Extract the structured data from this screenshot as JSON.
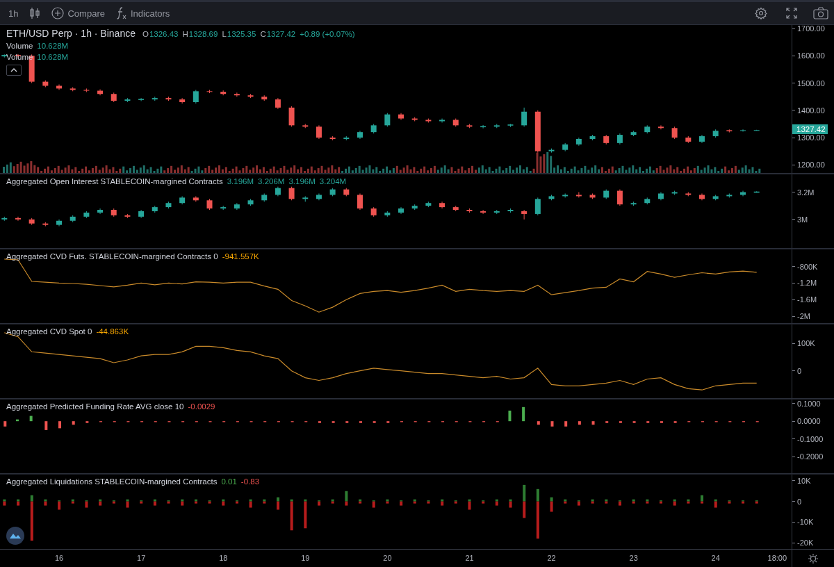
{
  "toolbar": {
    "interval": "1h",
    "compare": "Compare",
    "indicators": "Indicators"
  },
  "panes": [
    {
      "legend": {
        "title": "ETH/USD Perp · 1h · Binance",
        "ohlc": [
          {
            "label": "O",
            "value": "1326.43"
          },
          {
            "label": "H",
            "value": "1328.69"
          },
          {
            "label": "L",
            "value": "1325.35"
          },
          {
            "label": "C",
            "value": "1327.42"
          }
        ],
        "change": "+0.89 (+0.07%)",
        "studies": [
          {
            "name": "Volume",
            "value": "10.628M"
          },
          {
            "name": "Volume",
            "value": "10.628M"
          }
        ]
      },
      "last_price": "1327.42",
      "chart_data": {
        "type": "candlestick",
        "ylim": [
          1170,
          1713
        ],
        "yticks": [
          {
            "value": 1700,
            "label": "1700.00"
          },
          {
            "value": 1600,
            "label": "1600.00"
          },
          {
            "value": 1500,
            "label": "1500.00"
          },
          {
            "value": 1400,
            "label": "1400.00"
          },
          {
            "value": 1300,
            "label": "1300.00"
          },
          {
            "value": 1200,
            "label": "1200.00"
          }
        ],
        "categories": [
          null,
          null,
          null,
          null,
          null,
          null,
          null,
          null,
          null,
          null,
          null,
          null,
          null,
          null,
          null,
          null,
          null,
          null,
          null,
          null,
          null,
          null,
          null,
          null,
          null,
          null,
          null,
          null,
          null,
          null,
          null,
          null,
          null,
          null,
          null,
          null,
          null,
          null,
          null,
          null,
          null,
          null,
          null,
          null,
          null,
          null,
          null,
          null,
          null,
          null,
          null,
          null,
          null,
          null,
          null,
          null
        ],
        "ohlc": [
          [
            1598,
            1605,
            1594,
            1603
          ],
          [
            1603,
            1606,
            1594,
            1599
          ],
          [
            1600,
            1605,
            1500,
            1505
          ],
          [
            1505,
            1510,
            1485,
            1490
          ],
          [
            1490,
            1495,
            1475,
            1480
          ],
          [
            1480,
            1485,
            1470,
            1475
          ],
          [
            1475,
            1480,
            1467,
            1472
          ],
          [
            1472,
            1477,
            1455,
            1460
          ],
          [
            1460,
            1465,
            1430,
            1435
          ],
          [
            1435,
            1445,
            1430,
            1440
          ],
          [
            1438,
            1445,
            1434,
            1442
          ],
          [
            1440,
            1450,
            1435,
            1445
          ],
          [
            1445,
            1450,
            1435,
            1440
          ],
          [
            1440,
            1445,
            1425,
            1430
          ],
          [
            1430,
            1475,
            1425,
            1470
          ],
          [
            1470,
            1475,
            1463,
            1468
          ],
          [
            1468,
            1473,
            1455,
            1460
          ],
          [
            1460,
            1465,
            1450,
            1455
          ],
          [
            1455,
            1460,
            1445,
            1450
          ],
          [
            1450,
            1455,
            1435,
            1440
          ],
          [
            1440,
            1445,
            1405,
            1410
          ],
          [
            1410,
            1415,
            1340,
            1345
          ],
          [
            1345,
            1350,
            1335,
            1340
          ],
          [
            1340,
            1345,
            1295,
            1300
          ],
          [
            1300,
            1305,
            1290,
            1295
          ],
          [
            1295,
            1305,
            1290,
            1300
          ],
          [
            1300,
            1325,
            1295,
            1320
          ],
          [
            1320,
            1350,
            1315,
            1345
          ],
          [
            1345,
            1390,
            1340,
            1385
          ],
          [
            1385,
            1390,
            1365,
            1370
          ],
          [
            1370,
            1375,
            1360,
            1365
          ],
          [
            1365,
            1370,
            1355,
            1360
          ],
          [
            1360,
            1370,
            1355,
            1365
          ],
          [
            1365,
            1370,
            1340,
            1345
          ],
          [
            1345,
            1350,
            1335,
            1340
          ],
          [
            1338,
            1346,
            1334,
            1342
          ],
          [
            1340,
            1350,
            1335,
            1345
          ],
          [
            1344,
            1350,
            1339,
            1348
          ],
          [
            1345,
            1410,
            1340,
            1395
          ],
          [
            1395,
            1400,
            1245,
            1250
          ],
          [
            1250,
            1260,
            1245,
            1255
          ],
          [
            1255,
            1280,
            1250,
            1275
          ],
          [
            1275,
            1300,
            1270,
            1295
          ],
          [
            1295,
            1310,
            1290,
            1305
          ],
          [
            1305,
            1310,
            1275,
            1280
          ],
          [
            1280,
            1315,
            1275,
            1310
          ],
          [
            1310,
            1325,
            1305,
            1320
          ],
          [
            1320,
            1345,
            1315,
            1340
          ],
          [
            1340,
            1345,
            1330,
            1335
          ],
          [
            1335,
            1340,
            1295,
            1300
          ],
          [
            1300,
            1305,
            1280,
            1285
          ],
          [
            1285,
            1310,
            1280,
            1305
          ],
          [
            1305,
            1330,
            1300,
            1325
          ],
          [
            1327,
            1330,
            1319,
            1323
          ],
          [
            1325,
            1330,
            1322,
            1327
          ],
          [
            1326.43,
            1328.69,
            1325.35,
            1327.42
          ]
        ]
      }
    },
    {
      "legend": {
        "title": "Aggregated Open Interest STABLECOIN-margined Contracts",
        "values": [
          {
            "text": "3.196M",
            "color": "#26a69a"
          },
          {
            "text": "3.206M",
            "color": "#26a69a"
          },
          {
            "text": "3.196M",
            "color": "#26a69a"
          },
          {
            "text": "3.204M",
            "color": "#26a69a"
          }
        ]
      },
      "chart_data": {
        "type": "candlestick",
        "ylim": [
          2.79,
          3.33
        ],
        "yticks": [
          {
            "value": 3.2,
            "label": "3.2M"
          },
          {
            "value": 3,
            "label": "3M"
          }
        ],
        "categories": [
          null,
          null,
          null,
          null,
          null,
          null,
          null,
          null,
          null,
          null,
          null,
          null,
          null,
          null,
          null,
          null,
          null,
          null,
          null,
          null,
          null,
          null,
          null,
          null,
          null,
          null,
          null,
          null,
          null,
          null,
          null,
          null,
          null,
          null,
          null,
          null,
          null,
          null,
          null,
          null,
          null,
          null,
          null,
          null,
          null,
          null,
          null,
          null,
          null,
          null,
          null,
          null,
          null,
          null,
          null,
          null
        ],
        "ohlc": [
          [
            3.0,
            3.02,
            2.99,
            3.01
          ],
          [
            3.01,
            3.02,
            2.99,
            3.0
          ],
          [
            3.0,
            3.01,
            2.96,
            2.97
          ],
          [
            2.97,
            2.98,
            2.95,
            2.96
          ],
          [
            2.96,
            3.0,
            2.95,
            2.99
          ],
          [
            2.99,
            3.03,
            2.98,
            3.02
          ],
          [
            3.02,
            3.06,
            3.01,
            3.05
          ],
          [
            3.05,
            3.08,
            3.04,
            3.07
          ],
          [
            3.07,
            3.08,
            3.02,
            3.03
          ],
          [
            3.03,
            3.04,
            3.01,
            3.02
          ],
          [
            3.02,
            3.07,
            3.01,
            3.06
          ],
          [
            3.06,
            3.1,
            3.05,
            3.09
          ],
          [
            3.09,
            3.13,
            3.08,
            3.12
          ],
          [
            3.12,
            3.17,
            3.11,
            3.16
          ],
          [
            3.16,
            3.17,
            3.13,
            3.14
          ],
          [
            3.14,
            3.15,
            3.07,
            3.08
          ],
          [
            3.08,
            3.1,
            3.07,
            3.09
          ],
          [
            3.08,
            3.12,
            3.07,
            3.11
          ],
          [
            3.11,
            3.15,
            3.1,
            3.14
          ],
          [
            3.14,
            3.19,
            3.13,
            3.18
          ],
          [
            3.18,
            3.24,
            3.17,
            3.23
          ],
          [
            3.23,
            3.24,
            3.14,
            3.15
          ],
          [
            3.15,
            3.17,
            3.13,
            3.16
          ],
          [
            3.15,
            3.19,
            3.14,
            3.18
          ],
          [
            3.18,
            3.23,
            3.17,
            3.22
          ],
          [
            3.22,
            3.23,
            3.17,
            3.18
          ],
          [
            3.18,
            3.19,
            3.07,
            3.08
          ],
          [
            3.08,
            3.09,
            3.02,
            3.03
          ],
          [
            3.03,
            3.06,
            3.02,
            3.05
          ],
          [
            3.05,
            3.09,
            3.04,
            3.08
          ],
          [
            3.08,
            3.11,
            3.07,
            3.1
          ],
          [
            3.1,
            3.13,
            3.09,
            3.12
          ],
          [
            3.12,
            3.13,
            3.08,
            3.09
          ],
          [
            3.09,
            3.1,
            3.06,
            3.07
          ],
          [
            3.07,
            3.08,
            3.05,
            3.06
          ],
          [
            3.06,
            3.07,
            3.04,
            3.05
          ],
          [
            3.05,
            3.07,
            3.04,
            3.06
          ],
          [
            3.06,
            3.08,
            3.05,
            3.07
          ],
          [
            3.06,
            3.07,
            3.0,
            3.04
          ],
          [
            3.04,
            3.16,
            3.03,
            3.15
          ],
          [
            3.15,
            3.18,
            3.14,
            3.17
          ],
          [
            3.17,
            3.19,
            3.16,
            3.18
          ],
          [
            3.18,
            3.2,
            3.16,
            3.17
          ],
          [
            3.18,
            3.19,
            3.15,
            3.16
          ],
          [
            3.16,
            3.22,
            3.15,
            3.21
          ],
          [
            3.21,
            3.22,
            3.1,
            3.11
          ],
          [
            3.11,
            3.13,
            3.1,
            3.12
          ],
          [
            3.12,
            3.16,
            3.11,
            3.15
          ],
          [
            3.15,
            3.2,
            3.14,
            3.19
          ],
          [
            3.19,
            3.21,
            3.18,
            3.2
          ],
          [
            3.19,
            3.2,
            3.17,
            3.18
          ],
          [
            3.18,
            3.19,
            3.14,
            3.15
          ],
          [
            3.15,
            3.18,
            3.14,
            3.17
          ],
          [
            3.17,
            3.19,
            3.16,
            3.18
          ],
          [
            3.18,
            3.21,
            3.17,
            3.2
          ],
          [
            3.196,
            3.206,
            3.196,
            3.204
          ]
        ]
      }
    },
    {
      "legend": {
        "title": "Aggregated CVD Futs. STABLECOIN-margined Contracts 0",
        "values": [
          {
            "text": "-941.557K",
            "color": "#f7a600"
          }
        ]
      },
      "chart_data": {
        "type": "line",
        "ylim": [
          -2164000,
          -389000
        ],
        "yticks": [
          {
            "value": -800000,
            "label": "-800K"
          },
          {
            "value": -1200000,
            "label": "-1.2M"
          },
          {
            "value": -1600000,
            "label": "-1.6M"
          },
          {
            "value": -2000000,
            "label": "-2M"
          }
        ],
        "categories": [
          null,
          null,
          null,
          null,
          null,
          null,
          null,
          null,
          null,
          null,
          null,
          null,
          null,
          null,
          null,
          null,
          null,
          null,
          null,
          null,
          null,
          null,
          null,
          null,
          null,
          null,
          null,
          null,
          null,
          null,
          null,
          null,
          null,
          null,
          null,
          null,
          null,
          null,
          null,
          null,
          null,
          null,
          null,
          null,
          null,
          null,
          null,
          null,
          null,
          null,
          null,
          null,
          null,
          null,
          null,
          null
        ],
        "series": [
          {
            "color": "#c98a2a",
            "values": [
              -620000,
              -640000,
              -1160000,
              -1180000,
              -1200000,
              -1210000,
              -1230000,
              -1260000,
              -1290000,
              -1250000,
              -1200000,
              -1240000,
              -1200000,
              -1220000,
              -1170000,
              -1180000,
              -1200000,
              -1180000,
              -1180000,
              -1270000,
              -1350000,
              -1620000,
              -1750000,
              -1900000,
              -1780000,
              -1600000,
              -1450000,
              -1400000,
              -1380000,
              -1420000,
              -1380000,
              -1320000,
              -1250000,
              -1400000,
              -1350000,
              -1380000,
              -1400000,
              -1380000,
              -1400000,
              -1250000,
              -1480000,
              -1430000,
              -1380000,
              -1320000,
              -1300000,
              -1100000,
              -1170000,
              -920000,
              -980000,
              -1060000,
              -1000000,
              -950000,
              -980000,
              -930000,
              -910000,
              -940000
            ]
          }
        ]
      }
    },
    {
      "legend": {
        "title": "Aggregated CVD Spot 0",
        "values": [
          {
            "text": "-44.863K",
            "color": "#f7a600"
          }
        ]
      },
      "chart_data": {
        "type": "line",
        "ylim": [
          -100000,
          170000
        ],
        "yticks": [
          {
            "value": 100000,
            "label": "100K"
          },
          {
            "value": 0,
            "label": "0"
          }
        ],
        "categories": [
          null,
          null,
          null,
          null,
          null,
          null,
          null,
          null,
          null,
          null,
          null,
          null,
          null,
          null,
          null,
          null,
          null,
          null,
          null,
          null,
          null,
          null,
          null,
          null,
          null,
          null,
          null,
          null,
          null,
          null,
          null,
          null,
          null,
          null,
          null,
          null,
          null,
          null,
          null,
          null,
          null,
          null,
          null,
          null,
          null,
          null,
          null,
          null,
          null,
          null,
          null,
          null,
          null,
          null,
          null,
          null
        ],
        "series": [
          {
            "color": "#c98a2a",
            "values": [
              140000,
              125000,
              70000,
              65000,
              60000,
              55000,
              50000,
              45000,
              30000,
              40000,
              55000,
              60000,
              60000,
              70000,
              90000,
              90000,
              85000,
              75000,
              70000,
              55000,
              45000,
              0,
              -25000,
              -35000,
              -25000,
              -10000,
              0,
              10000,
              5000,
              0,
              -5000,
              -10000,
              -10000,
              -15000,
              -20000,
              -25000,
              -20000,
              -30000,
              -25000,
              10000,
              -50000,
              -55000,
              -55000,
              -50000,
              -45000,
              -35000,
              -50000,
              -30000,
              -25000,
              -50000,
              -65000,
              -70000,
              -55000,
              -50000,
              -45000,
              -45000
            ]
          }
        ]
      }
    },
    {
      "legend": {
        "title": "Aggregated Predicted Funding Rate AVG close 10",
        "values": [
          {
            "text": "-0.0029",
            "color": "#ef5350"
          }
        ]
      },
      "chart_data": {
        "type": "bar",
        "ylim": [
          -0.2943,
          0.1226
        ],
        "yticks": [
          {
            "value": 0.1,
            "label": "0.1000"
          },
          {
            "value": 0,
            "label": "0.0000"
          },
          {
            "value": -0.1,
            "label": "-0.1000"
          },
          {
            "value": -0.2,
            "label": "-0.2000"
          }
        ],
        "categories": [
          null,
          null,
          null,
          null,
          null,
          null,
          null,
          null,
          null,
          null,
          null,
          null,
          null,
          null,
          null,
          null,
          null,
          null,
          null,
          null,
          null,
          null,
          null,
          null,
          null,
          null,
          null,
          null,
          null,
          null,
          null,
          null,
          null,
          null,
          null,
          null,
          null,
          null,
          null,
          null,
          null,
          null,
          null,
          null,
          null,
          null,
          null,
          null,
          null,
          null,
          null,
          null,
          null,
          null,
          null,
          null
        ],
        "series": [
          {
            "color": "#4caf50",
            "values": [
              null,
              0.01,
              0.03,
              null,
              null,
              null,
              null,
              null,
              null,
              null,
              null,
              null,
              null,
              null,
              null,
              null,
              null,
              null,
              null,
              null,
              null,
              null,
              null,
              null,
              null,
              null,
              null,
              null,
              null,
              null,
              null,
              null,
              null,
              null,
              null,
              null,
              null,
              0.06,
              0.08,
              null,
              null,
              null,
              null,
              null,
              null,
              null,
              null,
              null,
              null,
              null,
              null,
              null,
              null,
              null,
              null,
              null
            ]
          },
          {
            "color": "#ef5350",
            "values": [
              -0.03,
              null,
              null,
              -0.05,
              -0.04,
              -0.02,
              -0.01,
              -0.005,
              -0.005,
              -0.005,
              -0.005,
              -0.005,
              -0.005,
              -0.005,
              -0.005,
              -0.005,
              -0.005,
              -0.005,
              -0.005,
              -0.005,
              -0.005,
              -0.005,
              -0.005,
              -0.01,
              -0.01,
              -0.01,
              -0.01,
              -0.01,
              -0.01,
              -0.005,
              -0.005,
              -0.005,
              -0.005,
              -0.005,
              -0.005,
              -0.005,
              -0.005,
              null,
              null,
              -0.02,
              -0.03,
              -0.03,
              -0.02,
              -0.02,
              -0.01,
              -0.01,
              -0.01,
              -0.01,
              -0.01,
              -0.01,
              -0.005,
              -0.005,
              -0.005,
              -0.005,
              -0.005,
              -0.005
            ]
          }
        ]
      }
    },
    {
      "legend": {
        "title": "Aggregated Liquidations STABLECOIN-margined Contracts",
        "values": [
          {
            "text": "0.01",
            "color": "#4caf50"
          },
          {
            "text": "-0.83",
            "color": "#ef5350"
          }
        ]
      },
      "last_time_label": "18:00",
      "chart_data": {
        "type": "bar",
        "stacked": true,
        "xlim": [
          15.279,
          25.442
        ],
        "ylim": [
          -23000,
          13000
        ],
        "yticks": [
          {
            "value": 10000,
            "label": "10K"
          },
          {
            "value": 0,
            "label": "0"
          },
          {
            "value": -10000,
            "label": "-10K"
          },
          {
            "value": -20000,
            "label": "-20K"
          }
        ],
        "xticks": [
          {
            "value": 16,
            "label": "16"
          },
          {
            "value": 17,
            "label": "17"
          },
          {
            "value": 18,
            "label": "18"
          },
          {
            "value": 19,
            "label": "19"
          },
          {
            "value": 20,
            "label": "20"
          },
          {
            "value": 21,
            "label": "21"
          },
          {
            "value": 22,
            "label": "22"
          },
          {
            "value": 23,
            "label": "23"
          },
          {
            "value": 24,
            "label": "24"
          }
        ],
        "x": [
          15.333,
          15.5,
          15.667,
          15.833,
          16,
          16.167,
          16.333,
          16.5,
          16.667,
          16.833,
          17,
          17.167,
          17.333,
          17.5,
          17.667,
          17.833,
          18,
          18.167,
          18.333,
          18.5,
          18.667,
          18.833,
          19,
          19.167,
          19.333,
          19.5,
          19.667,
          19.833,
          20,
          20.167,
          20.333,
          20.5,
          20.667,
          20.833,
          21,
          21.167,
          21.333,
          21.5,
          21.667,
          21.833,
          22,
          22.167,
          22.333,
          22.5,
          22.667,
          22.833,
          23,
          23.167,
          23.333,
          23.5,
          23.667,
          23.833,
          24,
          24.167,
          24.333,
          24.5
        ],
        "series": [
          {
            "color": "#2e7d32",
            "values": [
              1000,
              1000,
              3000,
              1000,
              500,
              1000,
              500,
              1000,
              500,
              1000,
              500,
              1000,
              500,
              1000,
              1000,
              500,
              1000,
              500,
              1000,
              1000,
              2000,
              1000,
              1000,
              500,
              1000,
              5000,
              1000,
              500,
              1000,
              500,
              1000,
              500,
              1000,
              500,
              1000,
              500,
              1000,
              1000,
              8000,
              6000,
              2000,
              1000,
              500,
              1000,
              1000,
              500,
              1000,
              1000,
              500,
              1000,
              1000,
              3000,
              1000,
              500,
              500,
              500
            ]
          },
          {
            "color": "#b71c1c",
            "values": [
              -2000,
              -2000,
              -19000,
              -2000,
              -4000,
              -1000,
              -3000,
              -2000,
              -1000,
              -3000,
              -1000,
              -2000,
              -1000,
              -2000,
              -1000,
              -1000,
              -2000,
              -1000,
              -3000,
              -1000,
              -4000,
              -14000,
              -13000,
              -2000,
              -1000,
              -2000,
              -1000,
              -3000,
              -1000,
              -2000,
              -1000,
              -1000,
              -2000,
              -1000,
              -4000,
              -1000,
              -2000,
              -3000,
              -8000,
              -18000,
              -5000,
              -1000,
              -2000,
              -1000,
              -1000,
              -2000,
              -1000,
              -1000,
              -1000,
              -2000,
              -1000,
              -1000,
              -3000,
              -1000,
              -1000,
              -1000
            ]
          }
        ]
      }
    }
  ]
}
